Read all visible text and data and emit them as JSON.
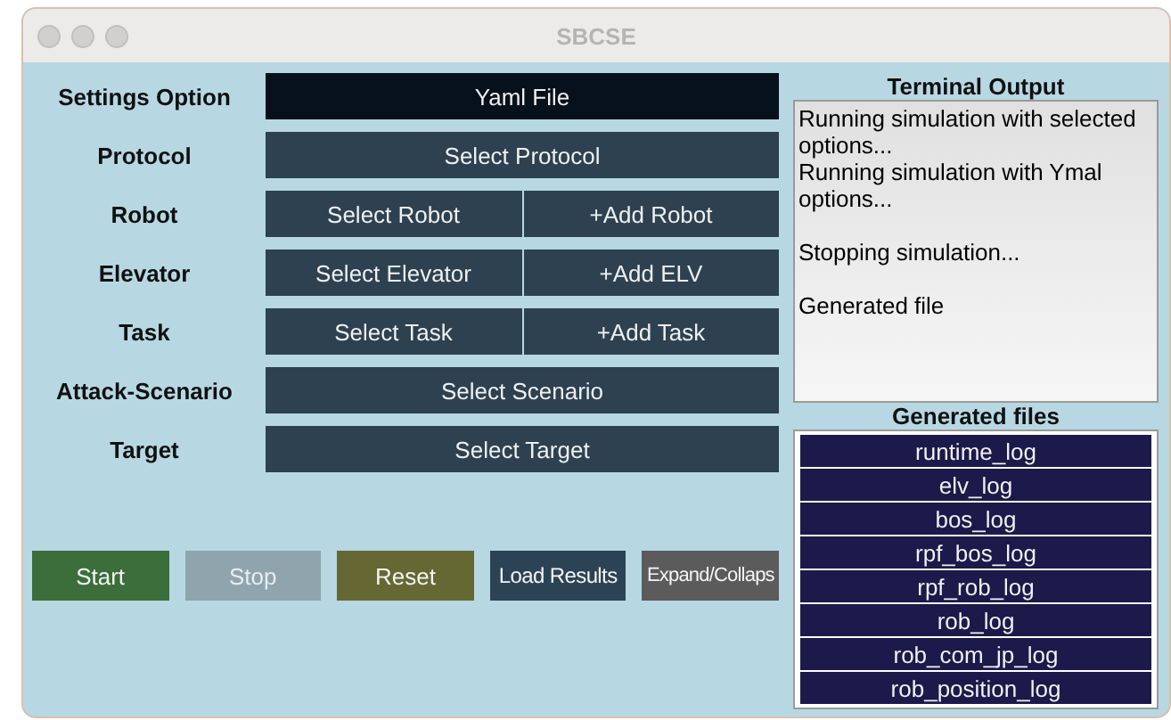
{
  "window": {
    "title": "SBCSE"
  },
  "settings": [
    {
      "label": "Settings Option",
      "buttons": [
        {
          "label": "Yaml File",
          "selected": true
        }
      ]
    },
    {
      "label": "Protocol",
      "buttons": [
        {
          "label": "Select Protocol",
          "selected": false
        }
      ]
    },
    {
      "label": "Robot",
      "buttons": [
        {
          "label": "Select Robot",
          "selected": false
        },
        {
          "label": "+Add Robot",
          "selected": false
        }
      ]
    },
    {
      "label": "Elevator",
      "buttons": [
        {
          "label": "Select Elevator",
          "selected": false
        },
        {
          "label": "+Add ELV",
          "selected": false
        }
      ]
    },
    {
      "label": "Task",
      "buttons": [
        {
          "label": "Select Task",
          "selected": false
        },
        {
          "label": "+Add Task",
          "selected": false
        }
      ]
    },
    {
      "label": "Attack-Scenario",
      "buttons": [
        {
          "label": "Select Scenario",
          "selected": false
        }
      ]
    },
    {
      "label": "Target",
      "buttons": [
        {
          "label": "Select Target",
          "selected": false
        }
      ]
    }
  ],
  "actions": [
    {
      "label": "Start",
      "color": "#3b6e3a",
      "disabled": false
    },
    {
      "label": "Stop",
      "color": "#8fa4ad",
      "disabled": true
    },
    {
      "label": "Reset",
      "color": "#666833",
      "disabled": false
    },
    {
      "label": "Load Results",
      "color": "#2c4356",
      "disabled": false
    },
    {
      "label": "Expand/Collaps",
      "color": "#5b5b5b",
      "disabled": false
    }
  ],
  "terminal": {
    "title": "Terminal Output",
    "lines": [
      {
        "text": "Running simulation with selected options...",
        "gap_before": false
      },
      {
        "text": "Running simulation with Ymal options...",
        "gap_before": false
      },
      {
        "text": "Stopping simulation...",
        "gap_before": true
      },
      {
        "text": "Generated file",
        "gap_before": true
      }
    ]
  },
  "generated_files": {
    "title": "Generated files",
    "items": [
      "runtime_log",
      "elv_log",
      "bos_log",
      "rpf_bos_log",
      "rpf_rob_log",
      "rob_log",
      "rob_com_jp_log",
      "rob_position_log"
    ]
  }
}
